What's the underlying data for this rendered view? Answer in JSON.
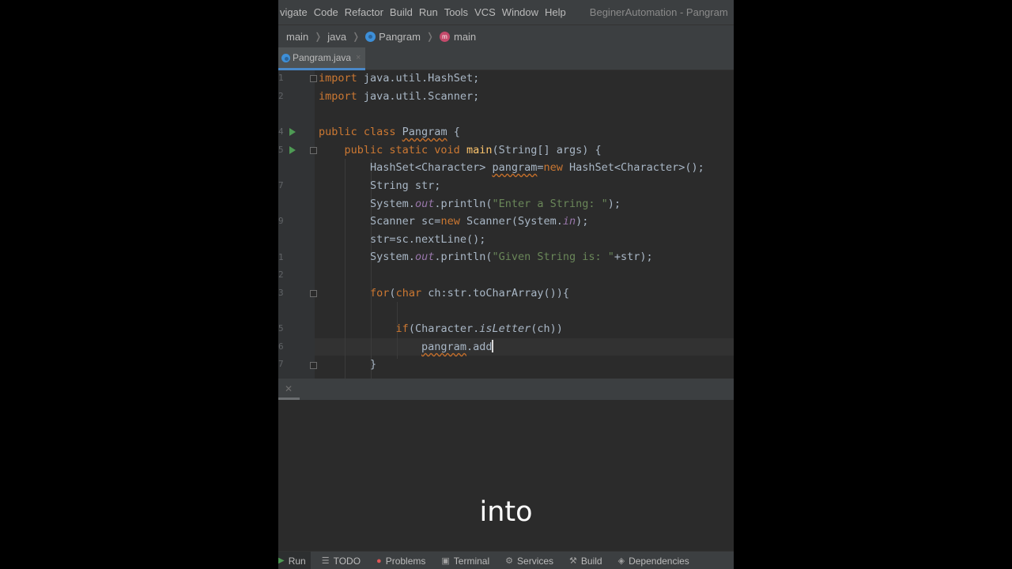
{
  "menu": [
    "vigate",
    "Code",
    "Refactor",
    "Build",
    "Run",
    "Tools",
    "VCS",
    "Window",
    "Help"
  ],
  "window_title": "BeginerAutomation - Pangram",
  "breadcrumb": {
    "item1": "main",
    "item2": "java",
    "item3": "Pangram",
    "item4": "main",
    "item4_icon_letter": "m"
  },
  "tab": {
    "label": "Pangram.java",
    "close": "×"
  },
  "line_numbers": [
    "1",
    "2",
    "",
    "4",
    "5",
    "",
    "7",
    "",
    "9",
    "",
    "1",
    "2",
    "3",
    "",
    "5",
    "6",
    "7"
  ],
  "code": {
    "l1": {
      "kw": "import",
      "rest": " java.util.HashSet;"
    },
    "l2": {
      "kw": "import",
      "rest": " java.util.Scanner;"
    },
    "l4": {
      "kw": "public class ",
      "name": "Pangram",
      "rest": " {"
    },
    "l5": {
      "indent": "    ",
      "kw": "public static void ",
      "fn": "main",
      "rest": "(String[] args) {"
    },
    "l6": {
      "indent": "        ",
      "a": "HashSet<Character> ",
      "var": "pangram",
      "b": "=",
      "kw": "new",
      "c": " HashSet<Character>();"
    },
    "l7": {
      "indent": "        ",
      "a": "String str;"
    },
    "l8": {
      "indent": "        ",
      "a": "System.",
      "fld": "out",
      "b": ".println(",
      "str": "\"Enter a String: \"",
      "c": ");"
    },
    "l9": {
      "indent": "        ",
      "a": "Scanner sc=",
      "kw": "new",
      "b": " Scanner(System.",
      "fld": "in",
      "c": ");"
    },
    "l10": {
      "indent": "        ",
      "a": "str=sc.nextLine();"
    },
    "l11": {
      "indent": "        ",
      "a": "System.",
      "fld": "out",
      "b": ".println(",
      "str": "\"Given String is: \"",
      "c": "+str);"
    },
    "l13": {
      "indent": "        ",
      "kw": "for",
      "a": "(",
      "kw2": "char",
      "b": " ch:str.toCharArray()){"
    },
    "l15": {
      "indent": "            ",
      "kw": "if",
      "a": "(Character.",
      "it": "isLetter",
      "b": "(ch))"
    },
    "l16": {
      "indent": "                ",
      "var": "pangram",
      "a": ".add"
    },
    "l17": {
      "indent": "        ",
      "a": "}"
    }
  },
  "bottom_tools": [
    "Run",
    "TODO",
    "Problems",
    "Terminal",
    "Services",
    "Build",
    "Dependencies"
  ],
  "subtitle": "into"
}
